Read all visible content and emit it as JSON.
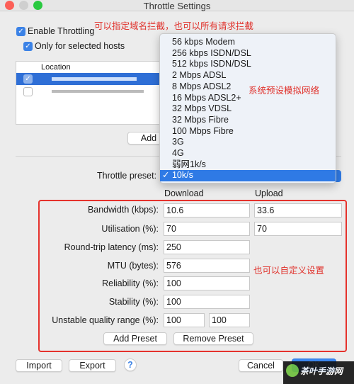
{
  "window": {
    "title": "Throttle Settings"
  },
  "annotations": {
    "top": "可以指定域名拦截，也可以所有请求拦截",
    "presets": "系统预设模拟网络",
    "custom": "也可以自定义设置"
  },
  "options": {
    "enable_throttling": "Enable Throttling",
    "enable_checked": true,
    "only_selected_hosts": "Only for selected hosts",
    "only_selected_checked": true
  },
  "hosts_table": {
    "header": "Location",
    "rows": [
      {
        "checked": true
      },
      {
        "checked": false
      }
    ]
  },
  "add_button": "Add",
  "preset": {
    "label": "Throttle preset:",
    "selected": "10k/s",
    "options": [
      "56 kbps Modem",
      "256 kbps ISDN/DSL",
      "512 kbps ISDN/DSL",
      "2 Mbps ADSL",
      "8 Mbps ADSL2",
      "16 Mbps ADSL2+",
      "32 Mbps VDSL",
      "32 Mbps Fibre",
      "100 Mbps Fibre",
      "3G",
      "4G",
      "弱网1k/s",
      "10k/s"
    ]
  },
  "columns": {
    "download": "Download",
    "upload": "Upload"
  },
  "fields": {
    "bandwidth": {
      "label": "Bandwidth (kbps):",
      "download": "10.6",
      "upload": "33.6"
    },
    "utilisation": {
      "label": "Utilisation (%):",
      "download": "70",
      "upload": "70"
    },
    "latency": {
      "label": "Round-trip latency (ms):",
      "value": "250"
    },
    "mtu": {
      "label": "MTU (bytes):",
      "value": "576"
    },
    "reliability": {
      "label": "Reliability (%):",
      "value": "100"
    },
    "stability": {
      "label": "Stability (%):",
      "value": "100"
    },
    "unstable": {
      "label": "Unstable quality range (%):",
      "min": "100",
      "max": "100"
    }
  },
  "buttons": {
    "add_preset": "Add Preset",
    "remove_preset": "Remove Preset",
    "import": "Import",
    "export": "Export",
    "help": "?",
    "cancel": "Cancel",
    "ok": "OK"
  },
  "watermark": "茶叶手游网",
  "colors": {
    "accent": "#2f7ae5",
    "annotation": "#e5322c"
  }
}
